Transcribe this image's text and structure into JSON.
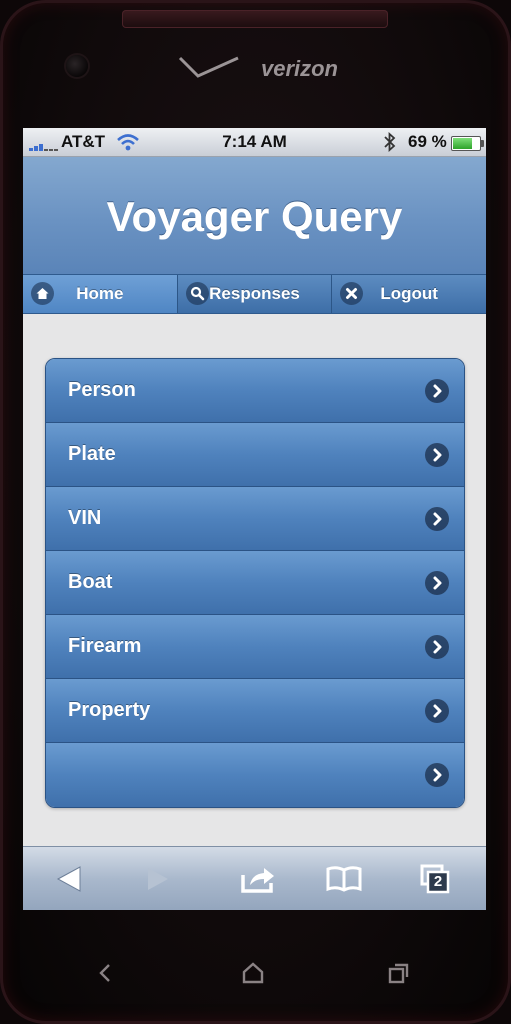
{
  "device": {
    "brand": "verizon"
  },
  "status_bar": {
    "carrier": "AT&T",
    "time": "7:14 AM",
    "battery": "69 %",
    "battery_level": 0.69
  },
  "header": {
    "title": "Voyager Query"
  },
  "nav": [
    {
      "label": "Home",
      "icon": "home-icon"
    },
    {
      "label": "Responses",
      "icon": "search-icon"
    },
    {
      "label": "Logout",
      "icon": "close-icon"
    }
  ],
  "list": [
    {
      "label": "Person"
    },
    {
      "label": "Plate"
    },
    {
      "label": "VIN"
    },
    {
      "label": "Boat"
    },
    {
      "label": "Firearm"
    },
    {
      "label": "Property"
    },
    {
      "label": ""
    }
  ],
  "toolbar": {
    "tabs_count": "2"
  }
}
